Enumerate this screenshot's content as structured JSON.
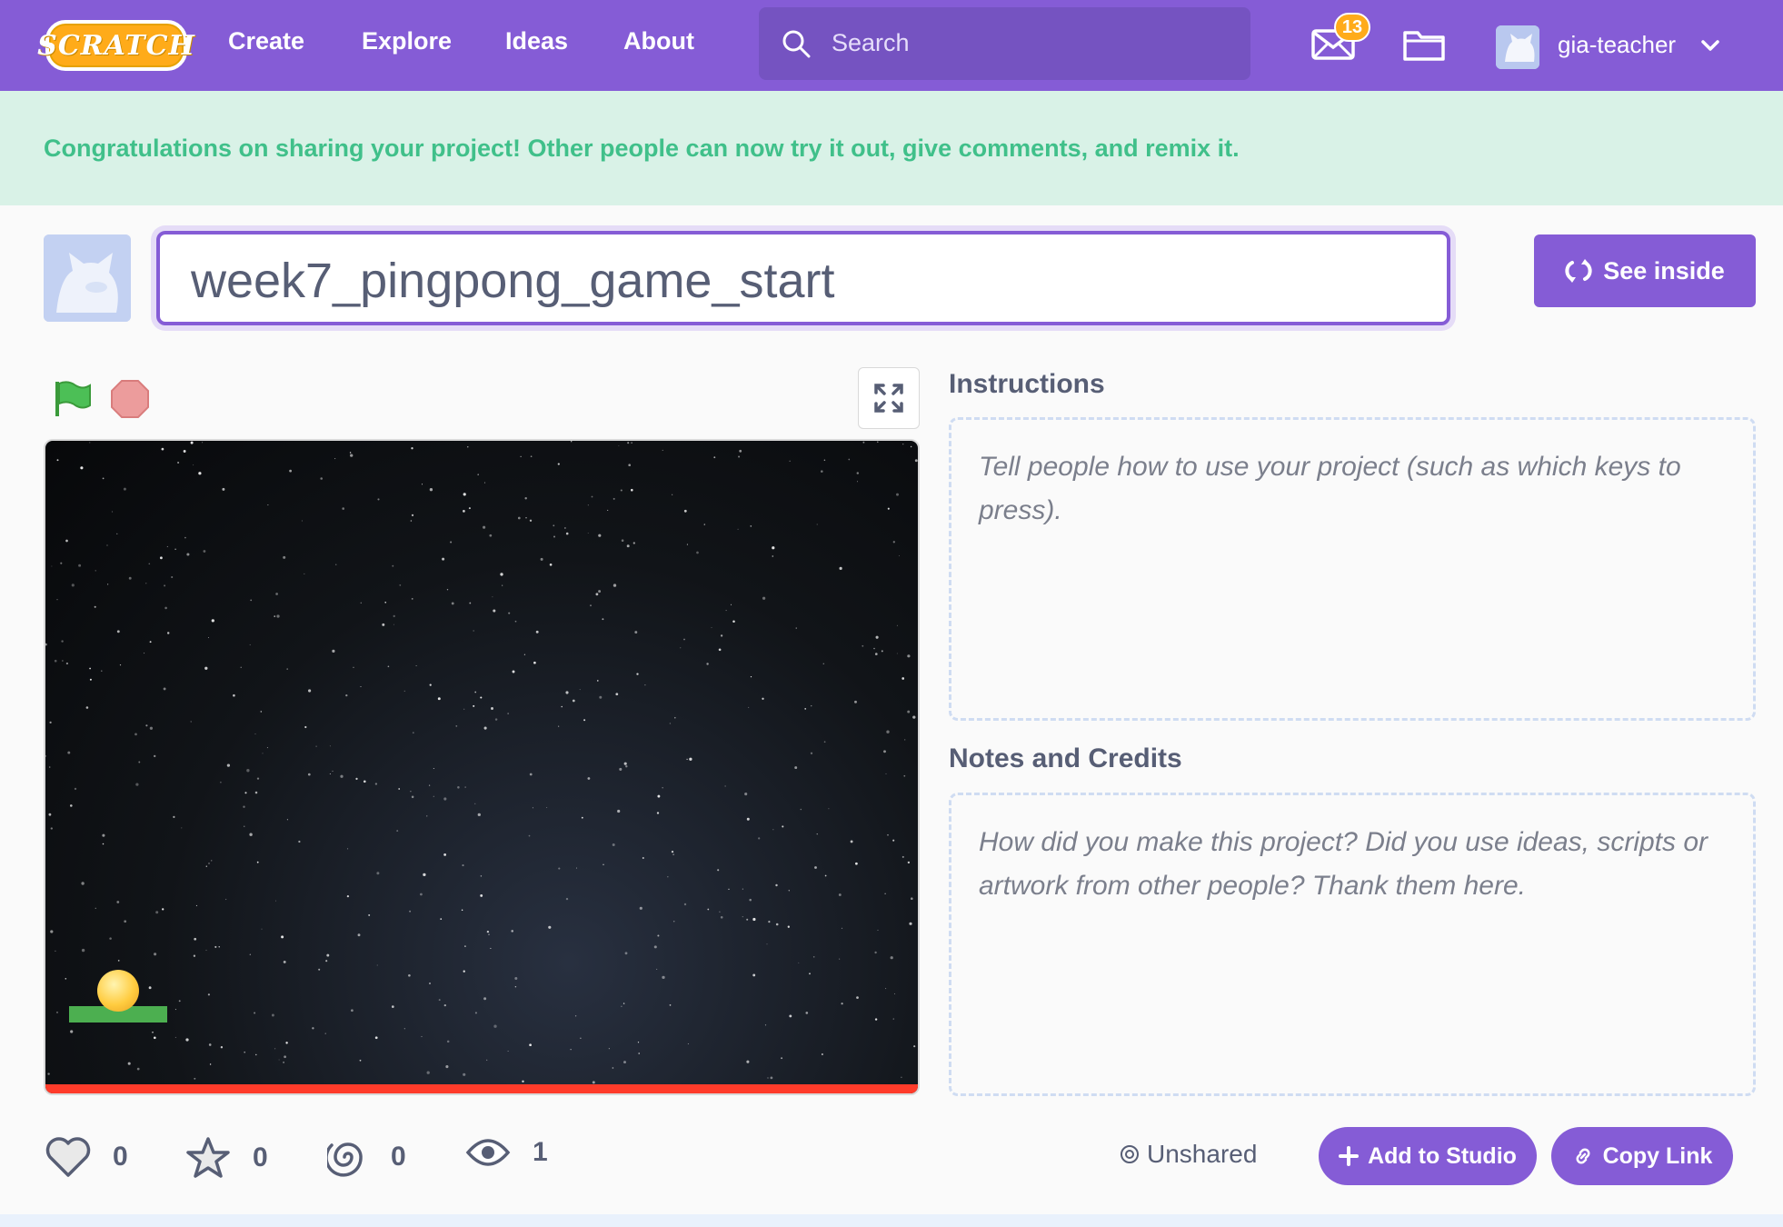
{
  "navbar": {
    "logo_text": "SCRATCH",
    "links": [
      "Create",
      "Explore",
      "Ideas",
      "About"
    ],
    "search_placeholder": "Search",
    "messages_count": "13",
    "username": "gia-teacher",
    "color": "#855cd6"
  },
  "banner": {
    "text": "Congratulations on sharing your project! Other people can now try it out, give comments, and remix it."
  },
  "project": {
    "title": "week7_pingpong_game_start",
    "see_inside_label": "See inside"
  },
  "instructions": {
    "heading": "Instructions",
    "placeholder": "Tell people how to use your project (such as which keys to press)."
  },
  "notes": {
    "heading": "Notes and Credits",
    "placeholder": "How did you make this project? Did you use ideas, scripts or artwork from other people? Thank them here."
  },
  "stats": {
    "loves": "0",
    "favorites": "0",
    "remixes": "0",
    "views": "1"
  },
  "footer_actions": {
    "status": "Unshared",
    "add_to_studio": "Add to Studio",
    "copy_link": "Copy Link"
  },
  "icons": [
    "search-icon",
    "messages-icon",
    "folder-icon",
    "chevron-down-icon",
    "green-flag-icon",
    "stop-icon",
    "fullscreen-icon",
    "remix-icon",
    "heart-icon",
    "star-icon",
    "swirl-icon",
    "eye-icon",
    "plus-icon",
    "link-icon"
  ]
}
